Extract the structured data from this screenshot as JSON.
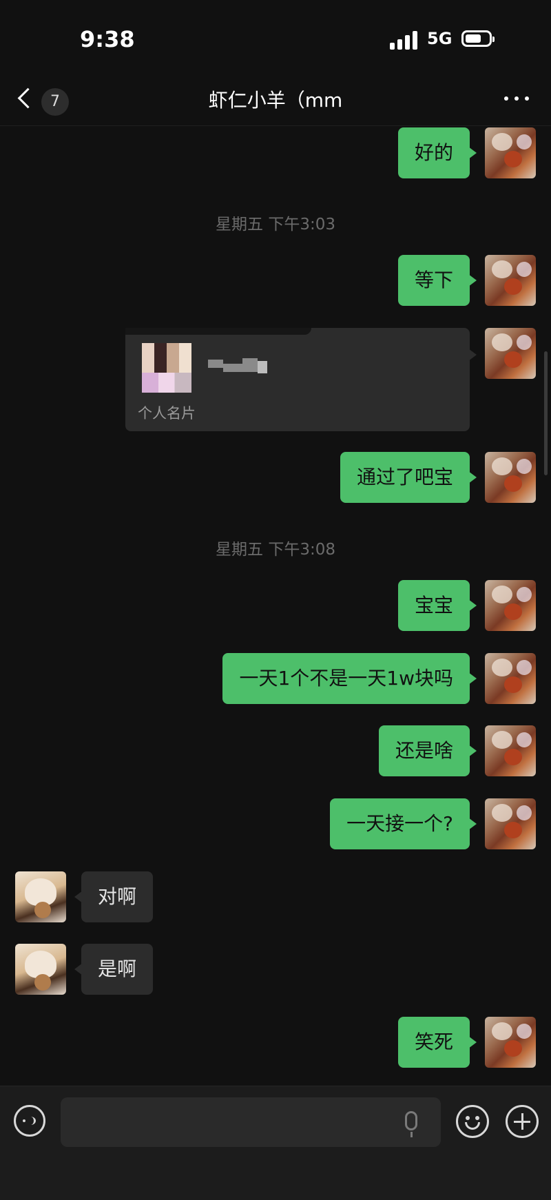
{
  "status_bar": {
    "time": "9:38",
    "network": "5G"
  },
  "header": {
    "unread_count": "7",
    "title": "虾仁小羊（mm"
  },
  "messages": [
    {
      "type": "text",
      "from": "me",
      "text": "好的"
    },
    {
      "type": "time",
      "text": "星期五 下午3:03"
    },
    {
      "type": "text",
      "from": "me",
      "text": "等下"
    },
    {
      "type": "card",
      "from": "me",
      "label": "个人名片"
    },
    {
      "type": "text",
      "from": "me",
      "text": "通过了吧宝"
    },
    {
      "type": "time",
      "text": "星期五 下午3:08"
    },
    {
      "type": "text",
      "from": "me",
      "text": "宝宝"
    },
    {
      "type": "text",
      "from": "me",
      "text": "一天1个不是一天1w块吗"
    },
    {
      "type": "text",
      "from": "me",
      "text": "还是啥"
    },
    {
      "type": "text",
      "from": "me",
      "text": "一天接一个?"
    },
    {
      "type": "text",
      "from": "other",
      "text": "对啊"
    },
    {
      "type": "text",
      "from": "other",
      "text": "是啊"
    },
    {
      "type": "text",
      "from": "me",
      "text": "笑死"
    }
  ],
  "input_bar": {
    "placeholder": ""
  },
  "colors": {
    "outgoing_bubble": "#4dbf6a",
    "incoming_bubble": "#2c2c2c",
    "background": "#111111"
  }
}
